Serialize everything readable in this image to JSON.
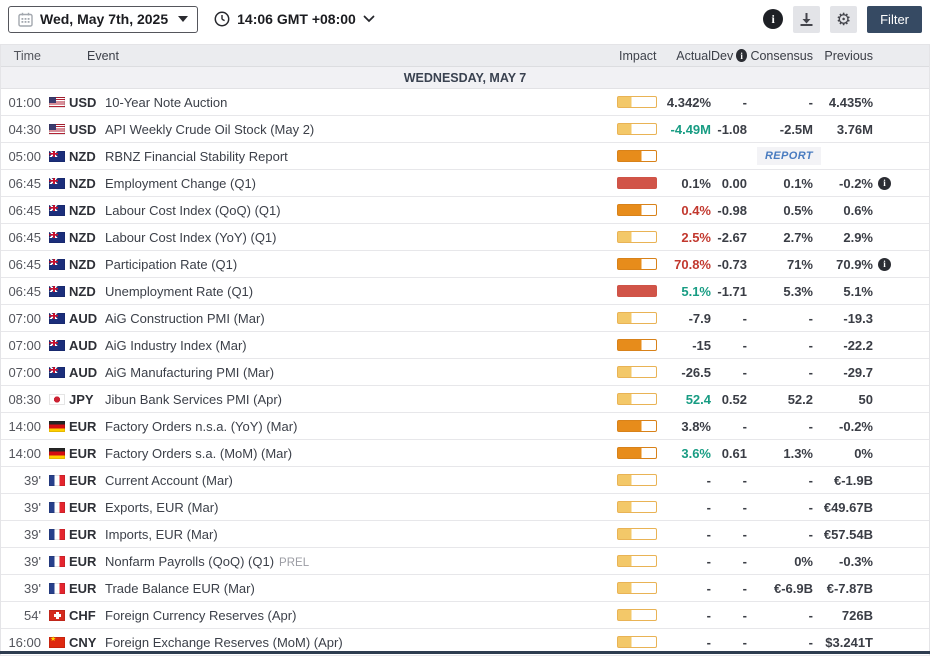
{
  "toolbar": {
    "date_label": "Wed, May 7th, 2025",
    "time_label": "14:06 GMT +08:00",
    "filter_label": "Filter"
  },
  "icons": {
    "info_glyph": "i",
    "gear_glyph": "⚙"
  },
  "colors": {
    "filter_button_bg": "#364a63",
    "impact_low_fill": "#f3c869",
    "impact_medium_fill": "#e78c1b",
    "impact_high_fill": "#d15448",
    "value_good": "#189c83",
    "value_bad": "#c2382e",
    "value_neutral": "#3a3d45",
    "report_link": "#4a7cc0"
  },
  "table": {
    "headers": {
      "time": "Time",
      "event": "Event",
      "impact": "Impact",
      "actual": "Actual",
      "dev": "Dev",
      "consensus": "Consensus",
      "previous": "Previous"
    },
    "section_header": "WEDNESDAY, MAY 7",
    "report_label": "REPORT",
    "rows": [
      {
        "time": "01:00",
        "currency": "USD",
        "flag": "us",
        "event": "10-Year Note Auction",
        "impact": "low",
        "actual": "4.342%",
        "actual_tone": "neutral",
        "dev": "-",
        "consensus": "-",
        "previous": "4.435%"
      },
      {
        "time": "04:30",
        "currency": "USD",
        "flag": "us",
        "event": "API Weekly Crude Oil Stock (May 2)",
        "impact": "low",
        "actual": "-4.49M",
        "actual_tone": "good",
        "dev": "-1.08",
        "consensus": "-2.5M",
        "previous": "3.76M"
      },
      {
        "time": "05:00",
        "currency": "NZD",
        "flag": "nz",
        "event": "RBNZ Financial Stability Report",
        "impact": "medium",
        "report": true,
        "actual": "",
        "dev": "",
        "consensus": "",
        "previous": ""
      },
      {
        "time": "06:45",
        "currency": "NZD",
        "flag": "nz",
        "event": "Employment Change (Q1)",
        "impact": "high",
        "actual": "0.1%",
        "actual_tone": "neutral",
        "dev": "0.00",
        "consensus": "0.1%",
        "previous": "-0.2%",
        "prev_info": true
      },
      {
        "time": "06:45",
        "currency": "NZD",
        "flag": "nz",
        "event": "Labour Cost Index (QoQ) (Q1)",
        "impact": "medium",
        "actual": "0.4%",
        "actual_tone": "bad",
        "dev": "-0.98",
        "consensus": "0.5%",
        "previous": "0.6%"
      },
      {
        "time": "06:45",
        "currency": "NZD",
        "flag": "nz",
        "event": "Labour Cost Index (YoY) (Q1)",
        "impact": "low",
        "actual": "2.5%",
        "actual_tone": "bad",
        "dev": "-2.67",
        "consensus": "2.7%",
        "previous": "2.9%"
      },
      {
        "time": "06:45",
        "currency": "NZD",
        "flag": "nz",
        "event": "Participation Rate (Q1)",
        "impact": "medium",
        "actual": "70.8%",
        "actual_tone": "bad",
        "dev": "-0.73",
        "consensus": "71%",
        "previous": "70.9%",
        "prev_info": true
      },
      {
        "time": "06:45",
        "currency": "NZD",
        "flag": "nz",
        "event": "Unemployment Rate (Q1)",
        "impact": "high",
        "actual": "5.1%",
        "actual_tone": "good",
        "dev": "-1.71",
        "consensus": "5.3%",
        "previous": "5.1%"
      },
      {
        "time": "07:00",
        "currency": "AUD",
        "flag": "au",
        "event": "AiG Construction PMI (Mar)",
        "impact": "low",
        "actual": "-7.9",
        "actual_tone": "neutral",
        "dev": "-",
        "consensus": "-",
        "previous": "-19.3"
      },
      {
        "time": "07:00",
        "currency": "AUD",
        "flag": "au",
        "event": "AiG Industry Index (Mar)",
        "impact": "medium",
        "actual": "-15",
        "actual_tone": "neutral",
        "dev": "-",
        "consensus": "-",
        "previous": "-22.2"
      },
      {
        "time": "07:00",
        "currency": "AUD",
        "flag": "au",
        "event": "AiG Manufacturing PMI (Mar)",
        "impact": "low",
        "actual": "-26.5",
        "actual_tone": "neutral",
        "dev": "-",
        "consensus": "-",
        "previous": "-29.7"
      },
      {
        "time": "08:30",
        "currency": "JPY",
        "flag": "jp",
        "event": "Jibun Bank Services PMI (Apr)",
        "impact": "low",
        "actual": "52.4",
        "actual_tone": "good",
        "dev": "0.52",
        "consensus": "52.2",
        "previous": "50"
      },
      {
        "time": "14:00",
        "currency": "EUR",
        "flag": "de",
        "event": "Factory Orders n.s.a. (YoY) (Mar)",
        "impact": "medium",
        "actual": "3.8%",
        "actual_tone": "neutral",
        "dev": "-",
        "consensus": "-",
        "previous": "-0.2%"
      },
      {
        "time": "14:00",
        "currency": "EUR",
        "flag": "de",
        "event": "Factory Orders s.a. (MoM) (Mar)",
        "impact": "medium",
        "actual": "3.6%",
        "actual_tone": "good",
        "dev": "0.61",
        "consensus": "1.3%",
        "previous": "0%"
      },
      {
        "time": "39'",
        "currency": "EUR",
        "flag": "fr",
        "event": "Current Account (Mar)",
        "impact": "low",
        "actual": "-",
        "actual_tone": "neutral",
        "dev": "-",
        "consensus": "-",
        "previous": "€-1.9B"
      },
      {
        "time": "39'",
        "currency": "EUR",
        "flag": "fr",
        "event": "Exports, EUR (Mar)",
        "impact": "low",
        "actual": "-",
        "actual_tone": "neutral",
        "dev": "-",
        "consensus": "-",
        "previous": "€49.67B"
      },
      {
        "time": "39'",
        "currency": "EUR",
        "flag": "fr",
        "event": "Imports, EUR (Mar)",
        "impact": "low",
        "actual": "-",
        "actual_tone": "neutral",
        "dev": "-",
        "consensus": "-",
        "previous": "€57.54B"
      },
      {
        "time": "39'",
        "currency": "EUR",
        "flag": "fr",
        "event": "Nonfarm Payrolls (QoQ) (Q1)",
        "suffix": "PREL",
        "impact": "low",
        "actual": "-",
        "actual_tone": "neutral",
        "dev": "-",
        "consensus": "0%",
        "previous": "-0.3%"
      },
      {
        "time": "39'",
        "currency": "EUR",
        "flag": "fr",
        "event": "Trade Balance EUR (Mar)",
        "impact": "low",
        "actual": "-",
        "actual_tone": "neutral",
        "dev": "-",
        "consensus": "€-6.9B",
        "previous": "€-7.87B"
      },
      {
        "time": "54'",
        "currency": "CHF",
        "flag": "ch",
        "event": "Foreign Currency Reserves (Apr)",
        "impact": "low",
        "actual": "-",
        "actual_tone": "neutral",
        "dev": "-",
        "consensus": "-",
        "previous": "726B"
      },
      {
        "time": "16:00",
        "currency": "CNY",
        "flag": "cn",
        "event": "Foreign Exchange Reserves (MoM) (Apr)",
        "impact": "low",
        "actual": "-",
        "actual_tone": "neutral",
        "dev": "-",
        "consensus": "-",
        "previous": "$3.241T"
      }
    ]
  }
}
